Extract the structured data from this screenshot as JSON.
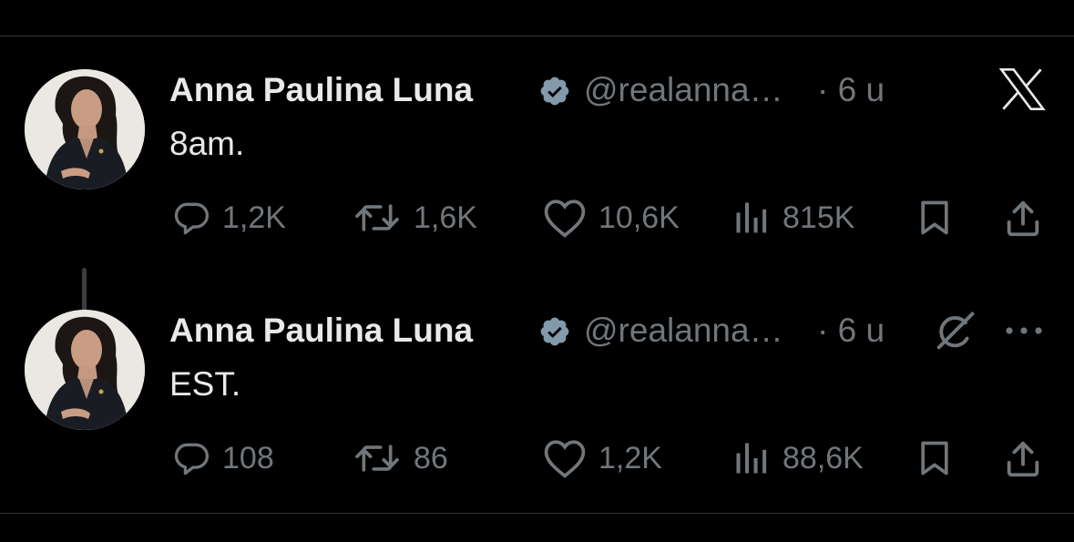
{
  "colors": {
    "background": "#000000",
    "text": "#e7e9ea",
    "muted": "#71767b",
    "verified": "#829aab"
  },
  "tweets": [
    {
      "author_name": "Anna Paulina Luna",
      "handle": "@realanna…",
      "time": "· 6 u",
      "text": "8am.",
      "replies": "1,2K",
      "reposts": "1,6K",
      "likes": "10,6K",
      "views": "815K",
      "corner_icon": "x-logo-icon"
    },
    {
      "author_name": "Anna Paulina Luna",
      "handle": "@realanna…",
      "time": "· 6 u",
      "text": "EST.",
      "replies": "108",
      "reposts": "86",
      "likes": "1,2K",
      "views": "88,6K",
      "corner_icon": "grok-icon"
    }
  ]
}
